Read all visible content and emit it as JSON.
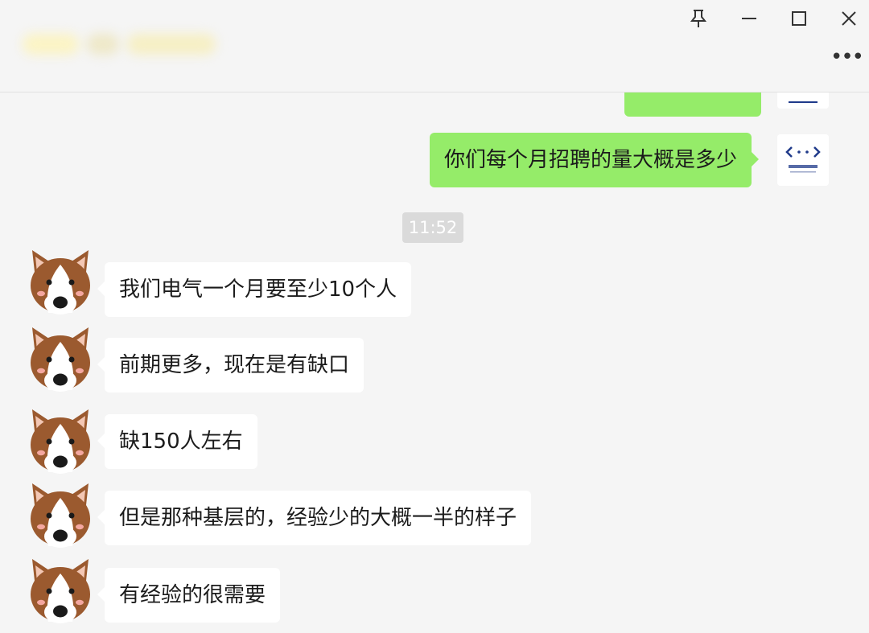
{
  "window": {
    "contact_title": "",
    "pin_icon": "pin-icon",
    "minimize_icon": "minimize-icon",
    "maximize_icon": "maximize-icon",
    "close_icon": "close-icon",
    "more_label": "•••"
  },
  "chat": {
    "timestamp": "11:52",
    "messages": [
      {
        "side": "right",
        "text": ""
      },
      {
        "side": "right",
        "text": "你们每个月招聘的量大概是多少"
      },
      {
        "side": "left",
        "text": "我们电气一个月要至少10个人"
      },
      {
        "side": "left",
        "text": "前期更多，现在是有缺口"
      },
      {
        "side": "left",
        "text": "缺150人左右"
      },
      {
        "side": "left",
        "text": "但是那种基层的，经验少的大概一半的样子"
      },
      {
        "side": "left",
        "text": "有经验的很需要"
      }
    ]
  },
  "colors": {
    "outgoing_bubble": "#95ec69",
    "incoming_bubble": "#ffffff",
    "background": "#f5f5f5",
    "timestamp_bg": "#dadada",
    "self_avatar_accent": "#1f3a8a",
    "dog_brown": "#9b5a2f"
  }
}
